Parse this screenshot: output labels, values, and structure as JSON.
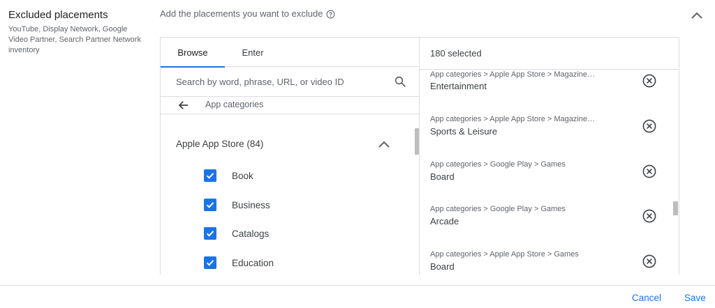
{
  "section": {
    "title": "Excluded placements",
    "description": "YouTube, Display Network, Google Video Partner, Search Partner Network inventory"
  },
  "prompt": {
    "text": "Add the placements you want to exclude",
    "help_icon": "help-circle-icon"
  },
  "tabs": [
    {
      "label": "Browse",
      "active": true
    },
    {
      "label": "Enter",
      "active": false
    }
  ],
  "search": {
    "placeholder": "Search by word, phrase, URL, or video ID",
    "value": ""
  },
  "breadcrumb": {
    "back_icon": "arrow-back-icon",
    "label": "App categories"
  },
  "group": {
    "label": "Apple App Store (84)",
    "expanded": true
  },
  "categories": [
    {
      "label": "Book",
      "checked": true
    },
    {
      "label": "Business",
      "checked": true
    },
    {
      "label": "Catalogs",
      "checked": true
    },
    {
      "label": "Education",
      "checked": true
    }
  ],
  "selected": {
    "count_label": "180 selected",
    "items": [
      {
        "path": "App categories > Apple App Store > Magazine…",
        "name": "Entertainment"
      },
      {
        "path": "App categories > Apple App Store > Magazine…",
        "name": "Sports & Leisure"
      },
      {
        "path": "App categories > Google Play > Games",
        "name": "Board"
      },
      {
        "path": "App categories > Google Play > Games",
        "name": "Arcade"
      },
      {
        "path": "App categories > Apple App Store > Games",
        "name": "Board"
      }
    ]
  },
  "footer": {
    "cancel_label": "Cancel",
    "save_label": "Save"
  },
  "colors": {
    "accent": "#1a73e8",
    "text": "#3c4043",
    "secondary_text": "#5f6368",
    "divider": "#dadce0"
  }
}
